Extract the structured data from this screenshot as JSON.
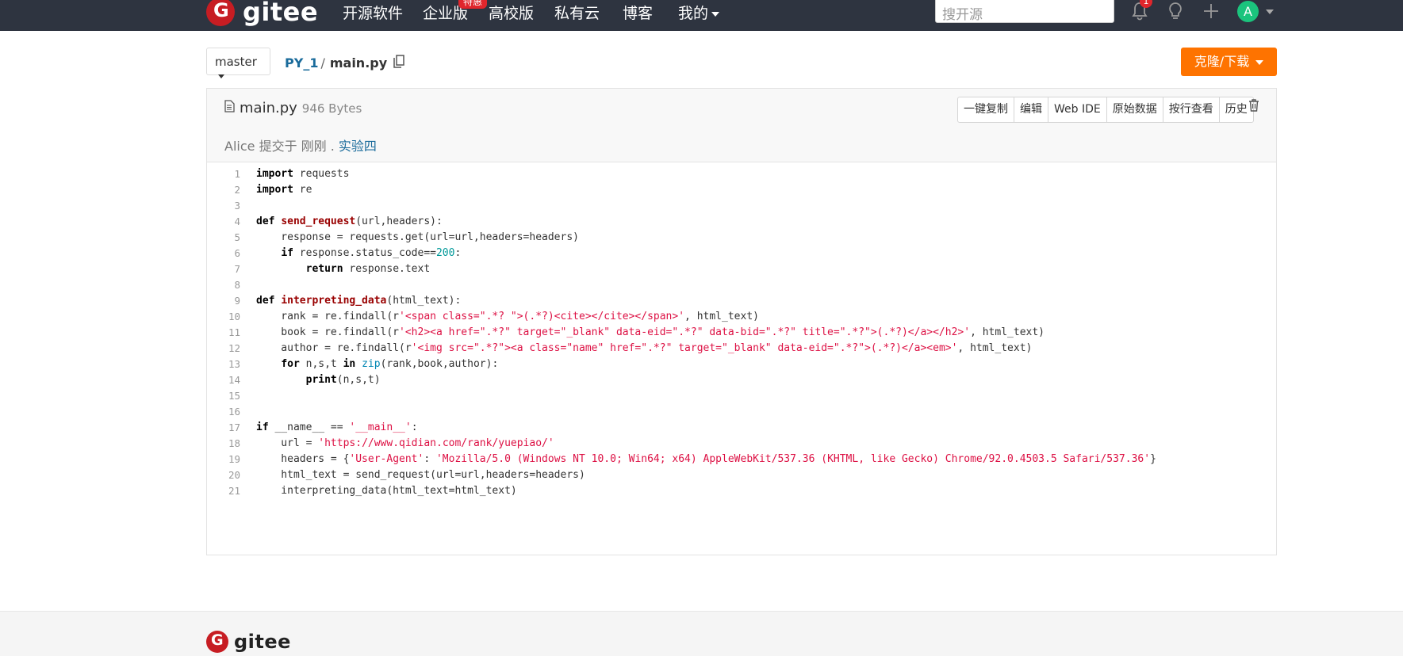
{
  "nav": {
    "logo_letter": "G",
    "logo_text": "gitee",
    "items": [
      "开源软件",
      "企业版",
      "高校版",
      "私有云",
      "博客",
      "我的"
    ],
    "enterprise_badge": "特惠",
    "search_placeholder": "搜开源",
    "notification_count": "1",
    "avatar_letter": "A"
  },
  "repo": {
    "branch": "master",
    "repo_name": "PY_1",
    "separator": "/",
    "file_name": "main.py",
    "clone_label": "克隆/下载"
  },
  "file": {
    "name": "main.py",
    "size": "946 Bytes",
    "actions": [
      "一键复制",
      "编辑",
      "Web IDE",
      "原始数据",
      "按行查看",
      "历史"
    ],
    "commit_prefix": "Alice 提交于 刚刚 .",
    "commit_message": "实验四"
  },
  "code_lines": [
    "import requests",
    "import re",
    "",
    "def send_request(url,headers):",
    "    response = requests.get(url=url,headers=headers)",
    "    if response.status_code==200:",
    "        return response.text",
    "",
    "def interpreting_data(html_text):",
    "    rank = re.findall(r'<span class=\".*? \">(.*?)<cite></cite></span>', html_text)",
    "    book = re.findall(r'<h2><a href=\".*?\" target=\"_blank\" data-eid=\".*?\" data-bid=\".*?\" title=\".*?\">(.*?)</a></h2>', html_text)",
    "    author = re.findall(r'<img src=\".*?\"><a class=\"name\" href=\".*?\" target=\"_blank\" data-eid=\".*?\">(.*?)</a><em>', html_text)",
    "    for n,s,t in zip(rank,book,author):",
    "        print(n,s,t)",
    "",
    "",
    "if __name__ == '__main__':",
    "    url = 'https://www.qidian.com/rank/yuepiao/'",
    "    headers = {'User-Agent': 'Mozilla/5.0 (Windows NT 10.0; Win64; x64) AppleWebKit/537.36 (KHTML, like Gecko) Chrome/92.0.4503.5 Safari/537.36'}",
    "    html_text = send_request(url=url,headers=headers)",
    "    interpreting_data(html_text=html_text)"
  ],
  "footer": {
    "logo_letter": "G",
    "logo_text": "gitee"
  },
  "colors": {
    "nav_bg": "#2e3440",
    "brand_red": "#c71d23",
    "clone_orange": "#fe7300",
    "link_blue": "#1a6b9b"
  }
}
